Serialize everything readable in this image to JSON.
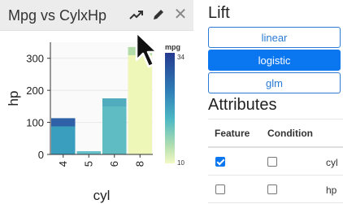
{
  "card": {
    "title": "Mpg vs CylxHp",
    "icons": [
      "trend-icon",
      "pencil-icon",
      "close-icon"
    ],
    "close_glyph": "✕"
  },
  "chart_data": {
    "type": "bar",
    "xlabel": "cyl",
    "ylabel": "hp",
    "categories": [
      "4",
      "5",
      "6",
      "8"
    ],
    "values": [
      113,
      10,
      175,
      335
    ],
    "ylim": [
      0,
      350
    ],
    "yticks": [
      "0",
      "100",
      "200",
      "300"
    ],
    "legend": {
      "title": "mpg",
      "max": "34",
      "min": "10"
    },
    "colors": {
      "high_mpg": "#2b3f96",
      "mid_mpg": "#3aa3c5",
      "low_mpg": "#eef5b8"
    }
  },
  "panel": {
    "lift_heading": "Lift",
    "buttons": [
      {
        "label": "linear",
        "active": false
      },
      {
        "label": "logistic",
        "active": true
      },
      {
        "label": "glm",
        "active": false
      }
    ],
    "attributes_heading": "Attributes",
    "table": {
      "headers": [
        "Feature",
        "Condition"
      ],
      "rows": [
        {
          "feature_checked": true,
          "condition_checked": false,
          "name": "cyl"
        },
        {
          "feature_checked": false,
          "condition_checked": false,
          "name": "hp"
        }
      ]
    }
  }
}
